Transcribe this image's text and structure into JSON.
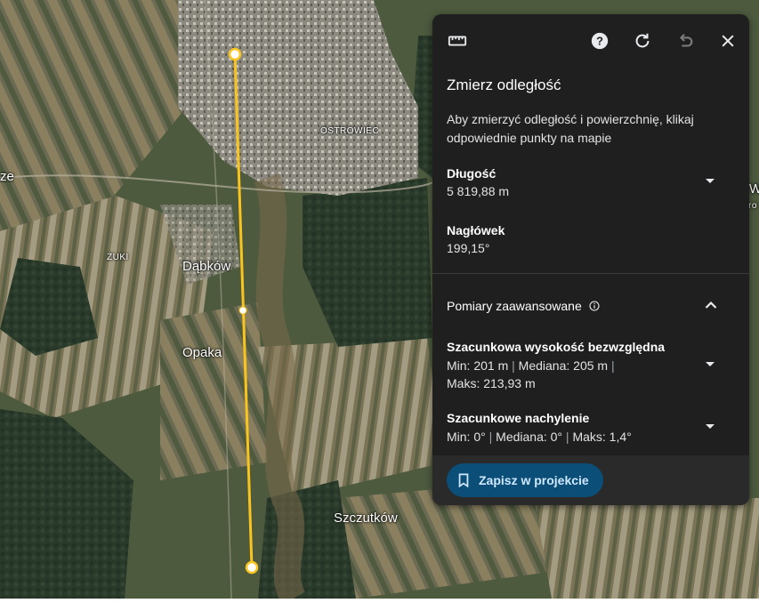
{
  "map": {
    "labels": {
      "ostrowiec": "OSTROWIEC",
      "zuki": "ŻUKI",
      "dabkow": "Dąbków",
      "opaka": "Opaka",
      "szczutkow": "Szczutków",
      "left_edge": "ze",
      "right_edge_w": "W",
      "right_edge_ro": "ro"
    }
  },
  "panel": {
    "icons": {
      "ruler": "ruler-icon",
      "help": "help-icon",
      "reset": "refresh-icon",
      "undo": "undo-icon",
      "close": "close-icon"
    },
    "title": "Zmierz odległość",
    "instructions": "Aby zmierzyć odległość i powierzchnię, klikaj odpowiednie punkty na mapie",
    "length": {
      "label": "Długość",
      "value": "5 819,88 m"
    },
    "heading": {
      "label": "Nagłówek",
      "value": "199,15°"
    },
    "advanced": {
      "label": "Pomiary zaawansowane",
      "elevation": {
        "label": "Szacunkowa wysokość bezwzględna",
        "min": "Min: 201 m",
        "median": "Mediana: 205 m",
        "max": "Maks: 213,93 m"
      },
      "slope": {
        "label": "Szacunkowe nachylenie",
        "min": "Min: 0°",
        "median": "Mediana: 0°",
        "max": "Maks: 1,4°"
      }
    },
    "save_label": "Zapisz w projekcie",
    "separator": "|"
  },
  "colors": {
    "panel_bg": "#1f1f1f",
    "accent_button": "#0b4e78",
    "measure_line": "#f9c41e"
  }
}
